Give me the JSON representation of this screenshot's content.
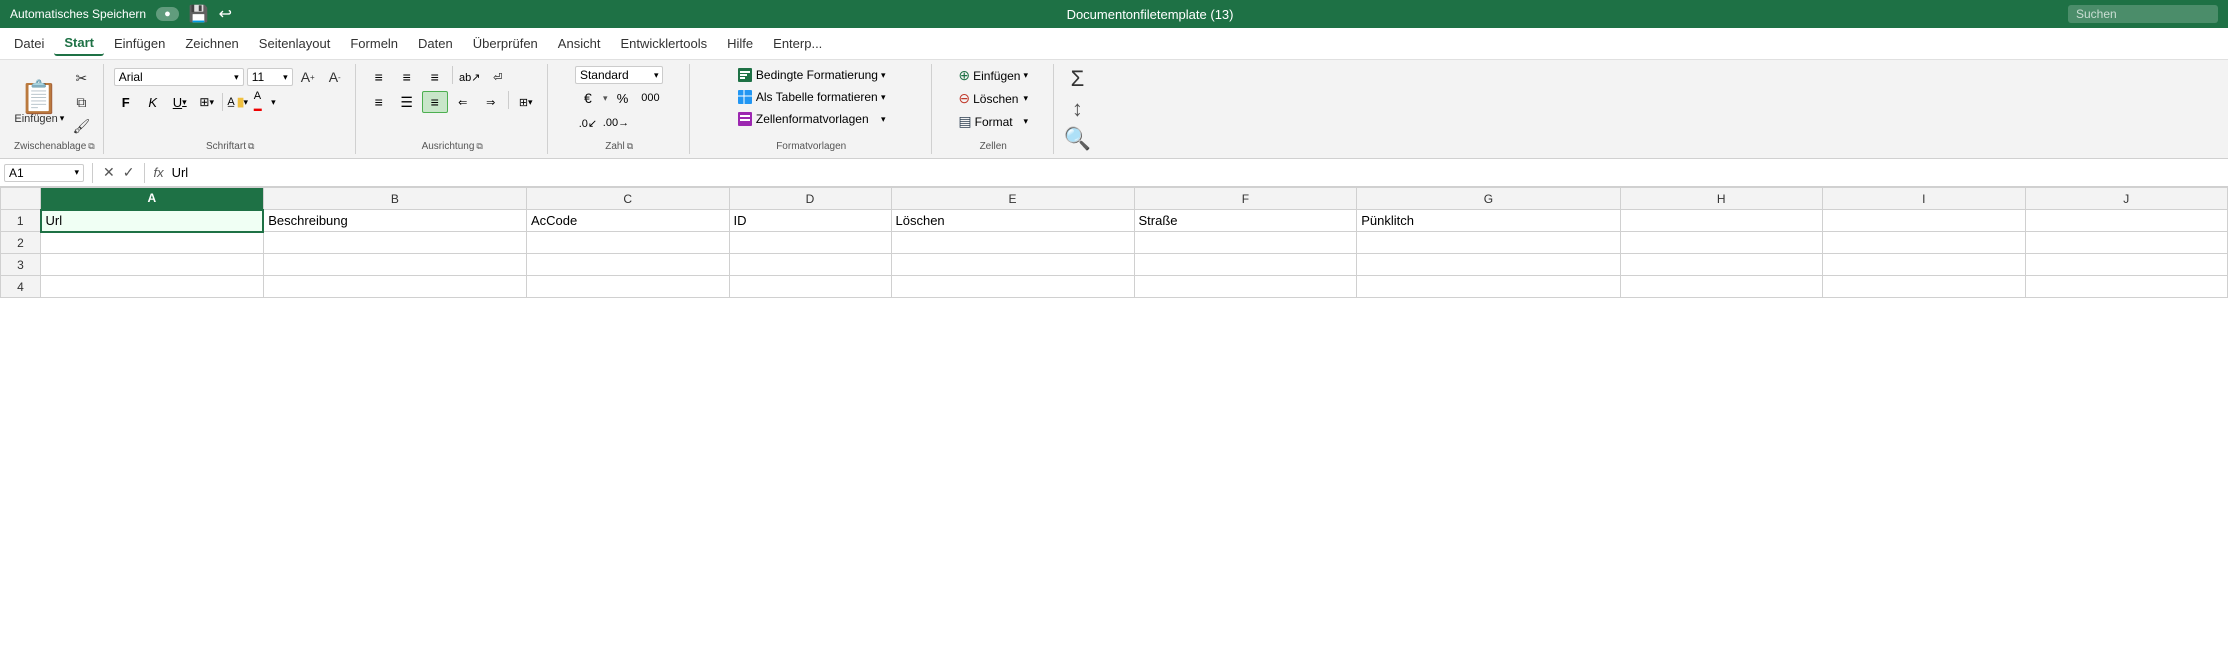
{
  "topbar": {
    "autosave_label": "Automatisches Speichern",
    "title": "Documentonfiletemplate (13)",
    "search_placeholder": "Suchen"
  },
  "menubar": {
    "items": [
      {
        "label": "Datei",
        "active": false
      },
      {
        "label": "Start",
        "active": true
      },
      {
        "label": "Einfügen",
        "active": false
      },
      {
        "label": "Zeichnen",
        "active": false
      },
      {
        "label": "Seitenlayout",
        "active": false
      },
      {
        "label": "Formeln",
        "active": false
      },
      {
        "label": "Daten",
        "active": false
      },
      {
        "label": "Überprüfen",
        "active": false
      },
      {
        "label": "Ansicht",
        "active": false
      },
      {
        "label": "Entwicklertools",
        "active": false
      },
      {
        "label": "Hilfe",
        "active": false
      },
      {
        "label": "Enterp...",
        "active": false
      }
    ]
  },
  "ribbon": {
    "zwischenablage": {
      "label": "Zwischenablage",
      "paste_label": "Einfügen"
    },
    "schriftart": {
      "label": "Schriftart",
      "font_name": "Arial",
      "font_size": "11",
      "bold_label": "F",
      "italic_label": "K",
      "underline_label": "U"
    },
    "ausrichtung": {
      "label": "Ausrichtung"
    },
    "zahl": {
      "label": "Zahl",
      "format_value": "Standard"
    },
    "formatvorlagen": {
      "label": "Formatvorlagen",
      "bedingte": "Bedingte Formatierung",
      "tabelle": "Als Tabelle formatieren",
      "zellen": "Zellenformatvorlagen"
    },
    "zellen": {
      "label": "Zellen",
      "einfuegen": "Einfügen",
      "loeschen": "Löschen",
      "format": "Format"
    }
  },
  "formulabar": {
    "cell_ref": "A1",
    "fx_label": "fx",
    "formula_value": "Url"
  },
  "spreadsheet": {
    "col_headers": [
      "",
      "A",
      "B",
      "C",
      "D",
      "E",
      "F",
      "G",
      "H",
      "I",
      "J"
    ],
    "rows": [
      {
        "number": "1",
        "cells": [
          "Url",
          "Beschreibung",
          "AcCode",
          "ID",
          "Löschen",
          "Straße",
          "Pünklitch",
          "",
          "",
          ""
        ]
      },
      {
        "number": "2",
        "cells": [
          "",
          "",
          "",
          "",
          "",
          "",
          "",
          "",
          "",
          ""
        ]
      },
      {
        "number": "3",
        "cells": [
          "",
          "",
          "",
          "",
          "",
          "",
          "",
          "",
          "",
          ""
        ]
      },
      {
        "number": "4",
        "cells": [
          "",
          "",
          "",
          "",
          "",
          "",
          "",
          "",
          "",
          ""
        ]
      }
    ]
  },
  "colors": {
    "excel_green": "#1e7145",
    "header_bg": "#f3f3f3",
    "selected_border": "#1e7145",
    "ribbon_bg": "#f3f3f3",
    "annotation_blue": "#0000cc"
  }
}
